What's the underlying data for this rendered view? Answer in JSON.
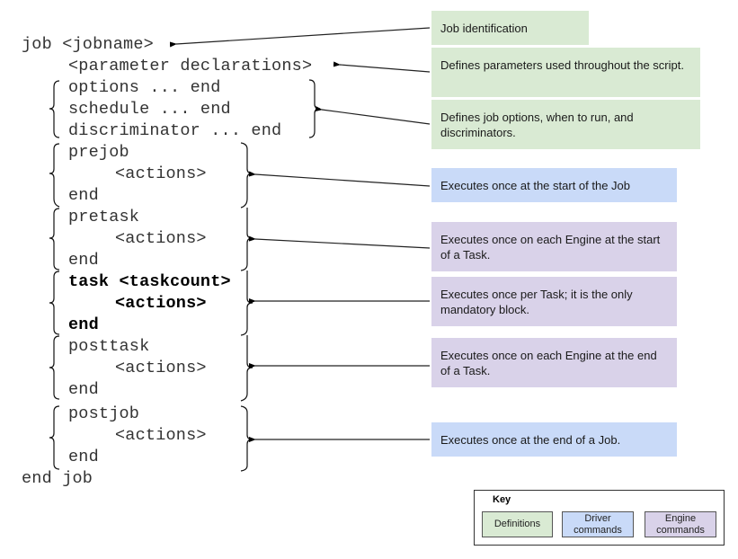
{
  "code_lines": {
    "job_open": "job <jobname>",
    "params": "<parameter declarations>",
    "options": "options ... end",
    "schedule": "schedule ... end",
    "discriminator": "discriminator ... end",
    "prejob": "prejob",
    "prejob_actions": "<actions>",
    "prejob_end": "end",
    "pretask": "pretask",
    "pretask_actions": "<actions>",
    "pretask_end": "end",
    "task": "task <taskcount>",
    "task_actions": "<actions>",
    "task_end": "end",
    "posttask": "posttask",
    "posttask_actions": "<actions>",
    "posttask_end": "end",
    "postjob": "postjob",
    "postjob_actions": "<actions>",
    "postjob_end": "end",
    "job_close": "end job"
  },
  "annotations": [
    {
      "text": "Job identification",
      "category": "Definitions"
    },
    {
      "text": "Defines parameters used throughout the script.",
      "category": "Definitions"
    },
    {
      "text": "Defines job options, when to run, and discriminators.",
      "category": "Definitions"
    },
    {
      "text": "Executes once at the start of the Job",
      "category": "Driver commands"
    },
    {
      "text": "Executes once on each Engine at the start of a Task.",
      "category": "Engine commands"
    },
    {
      "text": "Executes once per Task; it is the only mandatory block.",
      "category": "Engine commands"
    },
    {
      "text": "Executes once on each Engine at the end of a Task.",
      "category": "Engine commands"
    },
    {
      "text": "Executes once at the end of a Job.",
      "category": "Driver commands"
    }
  ],
  "key": {
    "title": "Key",
    "items": [
      {
        "label": "Definitions",
        "color": "#d9ead3"
      },
      {
        "label": "Driver commands",
        "color": "#c9daf8"
      },
      {
        "label": "Engine commands",
        "color": "#d9d2e9"
      }
    ]
  },
  "colors": {
    "definitions": "#d9ead3",
    "driver": "#c9daf8",
    "engine": "#d9d2e9"
  }
}
